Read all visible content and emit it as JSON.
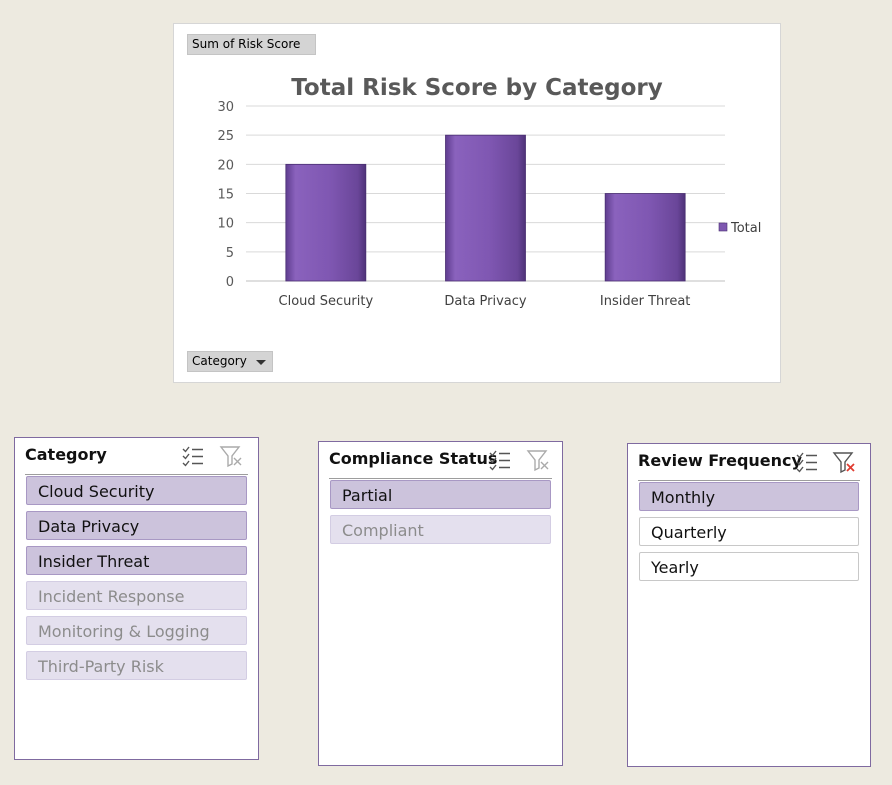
{
  "chart": {
    "value_field_button": "Sum of Risk Score",
    "axis_field_button": "Category",
    "legend_label": "Total"
  },
  "chart_data": {
    "type": "bar",
    "title": "Total Risk Score by Category",
    "categories": [
      "Cloud Security",
      "Data Privacy",
      "Insider Threat"
    ],
    "series": [
      {
        "name": "Total",
        "values": [
          20,
          25,
          15
        ],
        "color": "#7e58b0"
      }
    ],
    "yticks": [
      0,
      5,
      10,
      15,
      20,
      25,
      30
    ],
    "ylim": [
      0,
      30
    ],
    "xlabel": "",
    "ylabel": "",
    "grid": true,
    "legend": "right"
  },
  "slicers": {
    "category": {
      "title": "Category",
      "items": [
        {
          "label": "Cloud Security",
          "state": "sel"
        },
        {
          "label": "Data Privacy",
          "state": "sel"
        },
        {
          "label": "Insider Threat",
          "state": "sel"
        },
        {
          "label": "Incident Response",
          "state": "unsel-nodata"
        },
        {
          "label": "Monitoring & Logging",
          "state": "unsel-nodata"
        },
        {
          "label": "Third-Party Risk",
          "state": "unsel-nodata"
        }
      ]
    },
    "compliance": {
      "title": "Compliance Status",
      "items": [
        {
          "label": "Partial",
          "state": "sel"
        },
        {
          "label": "Compliant",
          "state": "unsel-nodata"
        }
      ]
    },
    "review": {
      "title": "Review Frequency",
      "items": [
        {
          "label": "Monthly",
          "state": "sel"
        },
        {
          "label": "Quarterly",
          "state": "unsel"
        },
        {
          "label": "Yearly",
          "state": "unsel"
        }
      ]
    }
  },
  "colors": {
    "background": "#edeae0",
    "selected_item": "#ccc3dc",
    "unselected_no_data": "#e4e0ee",
    "slicer_border": "#7f6aa0",
    "clear_filter_active": "#e03c31"
  },
  "icons": {
    "multi_select": "multi-select-icon",
    "clear_filter": "clear-filter-icon"
  }
}
